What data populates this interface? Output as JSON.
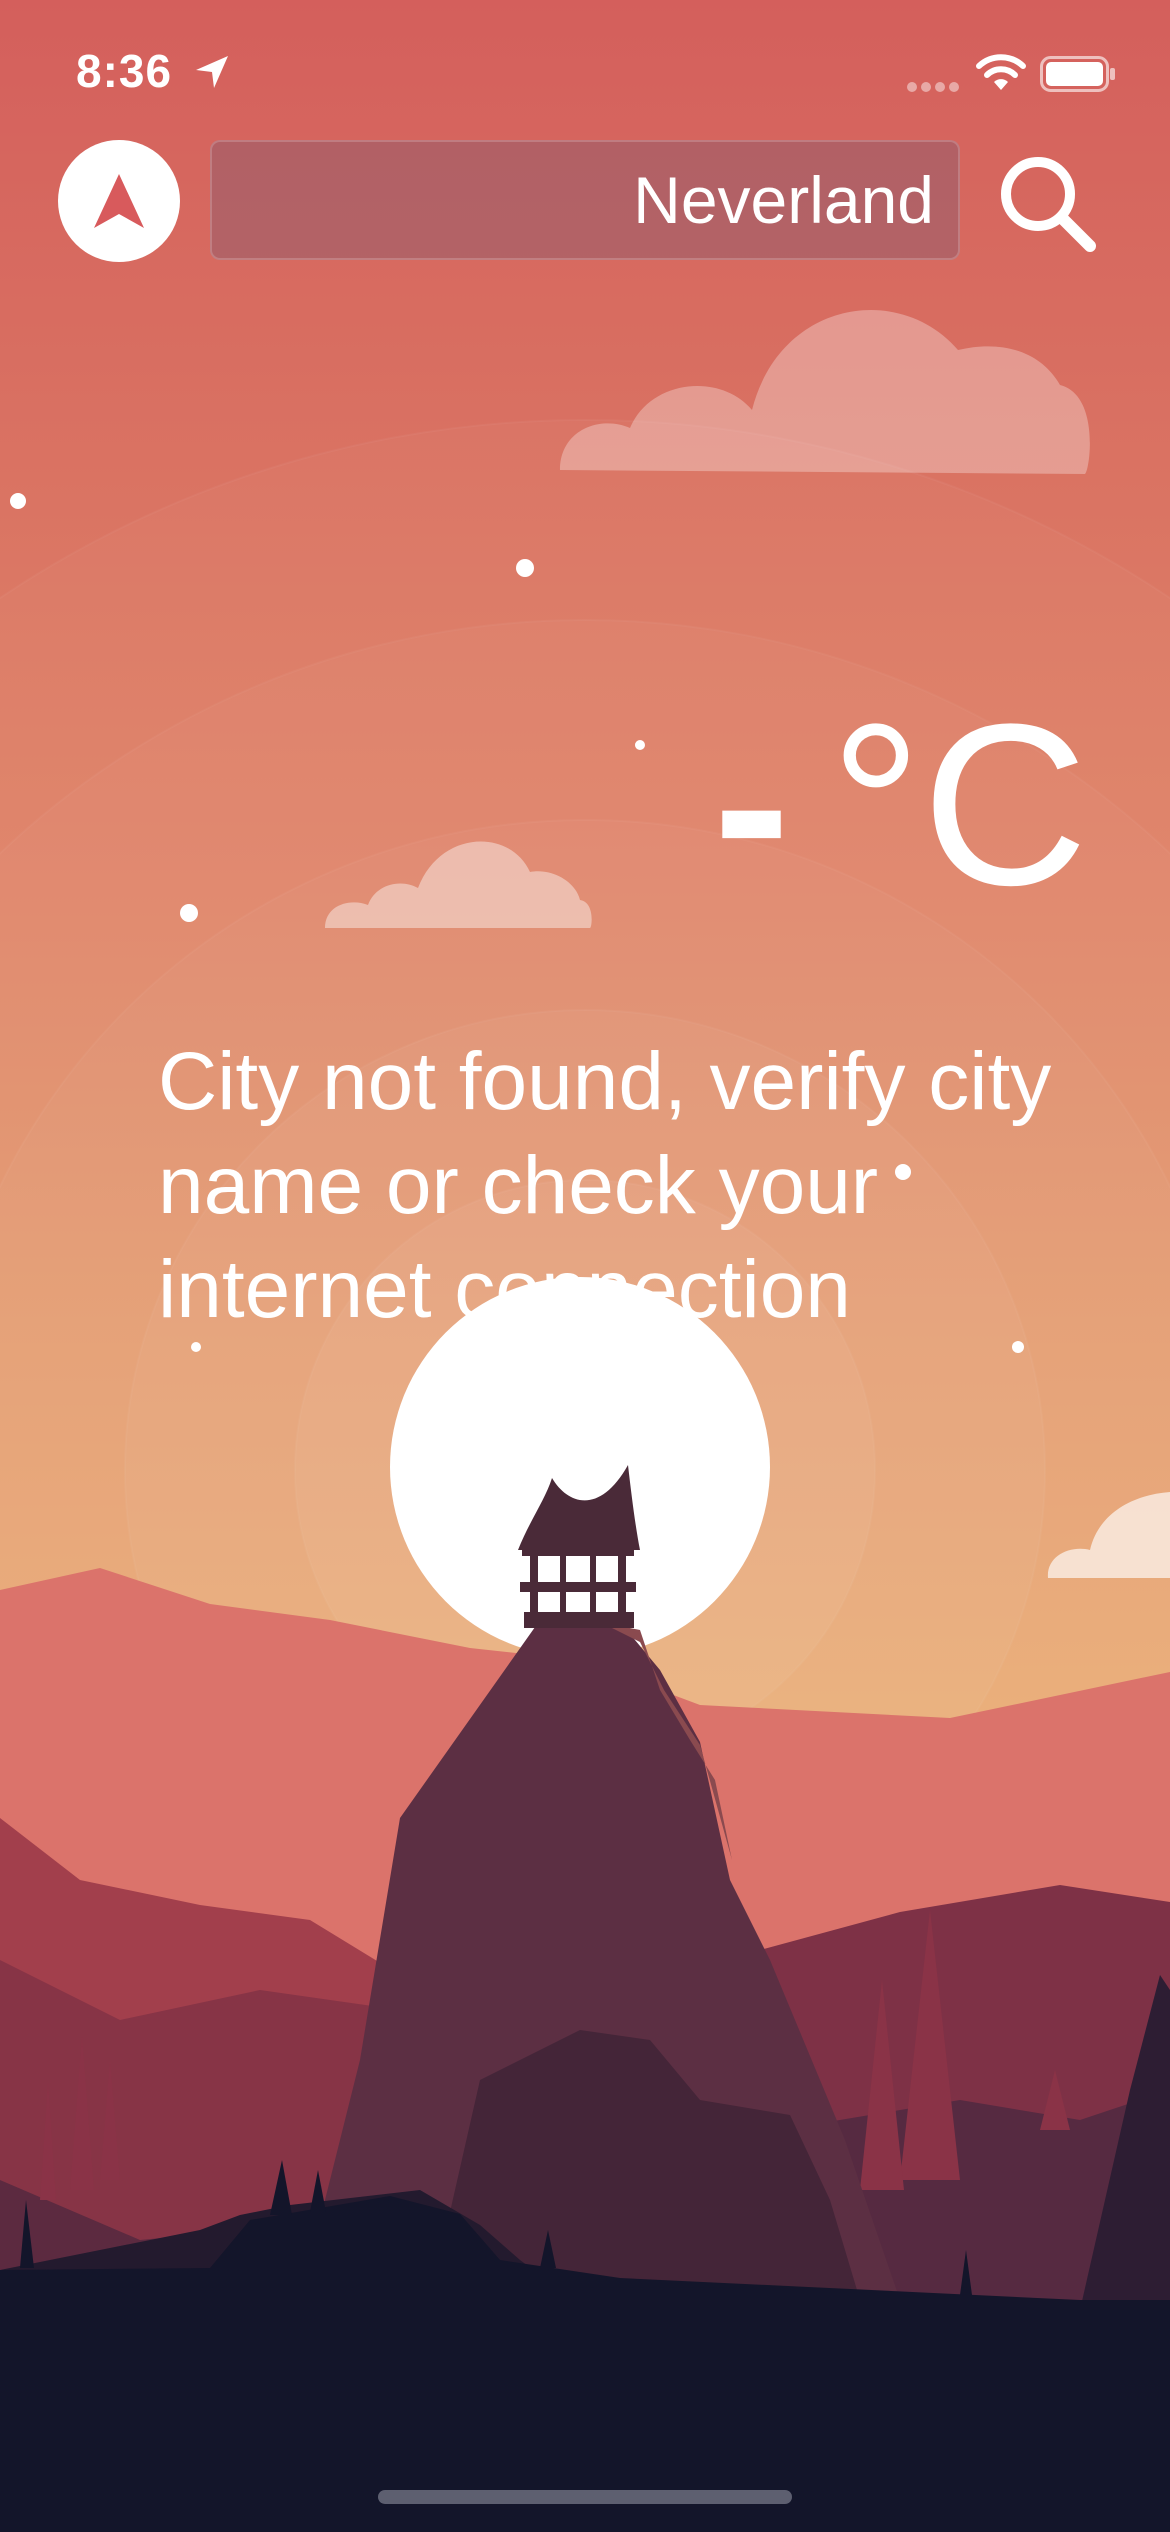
{
  "status_bar": {
    "time": "8:36",
    "location_icon": "location-arrow-icon",
    "signal_icon": "signal-dots-icon",
    "wifi_icon": "wifi-icon",
    "battery_icon": "battery-icon"
  },
  "header": {
    "nav_icon": "navigation-arrow-icon",
    "search": {
      "value": "Neverland"
    },
    "search_icon": "search-icon"
  },
  "weather": {
    "temperature_value": "-",
    "temperature_unit": "°C",
    "message": "City not found, verify city name or check your internet connection"
  },
  "colors": {
    "sky_top": "#d45f5c",
    "sky_bottom": "#ecb06f",
    "sun": "#ffffff",
    "ground": "#13152a"
  }
}
